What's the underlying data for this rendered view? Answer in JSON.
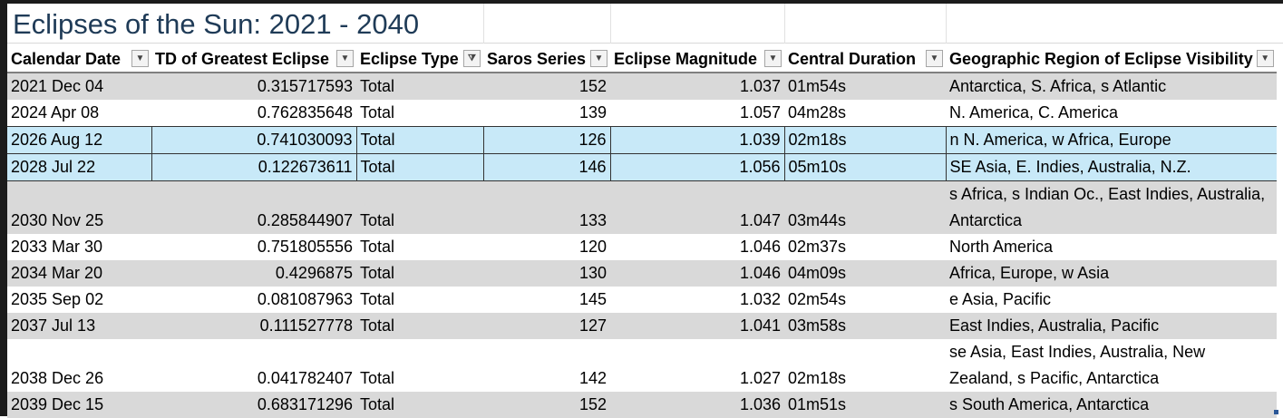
{
  "title": "Eclipses of the Sun: 2021 - 2040",
  "columns": [
    "Calendar Date",
    "TD of Greatest Eclipse",
    "Eclipse Type",
    "Saros Series",
    "Eclipse Magnitude",
    "Central Duration",
    "Geographic Region of Eclipse Visibility"
  ],
  "filter_icons": [
    "dropdown-arrow-icon",
    "dropdown-arrow-icon",
    "filter-active-icon",
    "dropdown-arrow-icon",
    "dropdown-arrow-icon",
    "dropdown-arrow-icon",
    "dropdown-arrow-icon"
  ],
  "rows": [
    {
      "date": "2021 Dec 04",
      "td": "0.315717593",
      "type": "Total",
      "saros": "152",
      "mag": "1.037",
      "dur": "01m54s",
      "region": "Antarctica, S. Africa, s Atlantic"
    },
    {
      "date": "2024 Apr 08",
      "td": "0.762835648",
      "type": "Total",
      "saros": "139",
      "mag": "1.057",
      "dur": "04m28s",
      "region": "N. America, C. America"
    },
    {
      "date": "2026 Aug 12",
      "td": "0.741030093",
      "type": "Total",
      "saros": "126",
      "mag": "1.039",
      "dur": "02m18s",
      "region": "n N. America, w Africa, Europe"
    },
    {
      "date": "2028 Jul 22",
      "td": "0.122673611",
      "type": "Total",
      "saros": "146",
      "mag": "1.056",
      "dur": "05m10s",
      "region": "SE Asia, E. Indies, Australia, N.Z."
    },
    {
      "date": "2030 Nov 25",
      "td": "0.285844907",
      "type": "Total",
      "saros": "133",
      "mag": "1.047",
      "dur": "03m44s",
      "region": "s Africa, s Indian Oc., East Indies, Australia, Antarctica"
    },
    {
      "date": "2033 Mar 30",
      "td": "0.751805556",
      "type": "Total",
      "saros": "120",
      "mag": "1.046",
      "dur": "02m37s",
      "region": "North America"
    },
    {
      "date": "2034 Mar 20",
      "td": "0.4296875",
      "type": "Total",
      "saros": "130",
      "mag": "1.046",
      "dur": "04m09s",
      "region": "Africa, Europe, w Asia"
    },
    {
      "date": "2035 Sep 02",
      "td": "0.081087963",
      "type": "Total",
      "saros": "145",
      "mag": "1.032",
      "dur": "02m54s",
      "region": "e Asia, Pacific"
    },
    {
      "date": "2037 Jul 13",
      "td": "0.111527778",
      "type": "Total",
      "saros": "127",
      "mag": "1.041",
      "dur": "03m58s",
      "region": "East Indies, Australia, Pacific"
    },
    {
      "date": "2038 Dec 26",
      "td": "0.041782407",
      "type": "Total",
      "saros": "142",
      "mag": "1.027",
      "dur": "02m18s",
      "region": "se Asia, East Indies, Australia, New Zealand, s Pacific, Antarctica"
    },
    {
      "date": "2039 Dec 15",
      "td": "0.683171296",
      "type": "Total",
      "saros": "152",
      "mag": "1.036",
      "dur": "01m51s",
      "region": "s South America, Antarctica"
    }
  ]
}
